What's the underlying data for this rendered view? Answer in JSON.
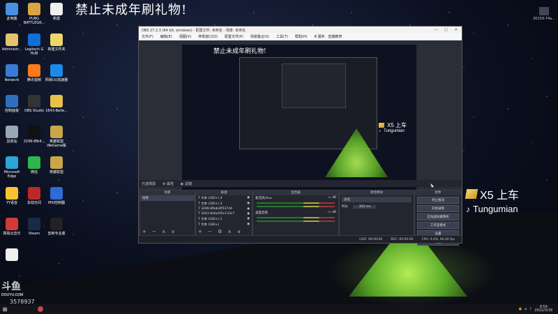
{
  "banner": "禁止未成年刷礼物!",
  "top_right_label": "30159-74a...",
  "desktop_icons": [
    {
      "label": "此电脑",
      "color": "#4a90e2"
    },
    {
      "label": "PUBG BATTLEGR...",
      "color": "#d9a441"
    },
    {
      "label": "新建",
      "color": "#eeeeee"
    },
    {
      "label": "Administr...",
      "color": "#e6c36a"
    },
    {
      "label": "Logitech G HUB",
      "color": "#0e6fd8"
    },
    {
      "label": "新建文件夹",
      "color": "#f0d56a"
    },
    {
      "label": "Network",
      "color": "#3a7bd5"
    },
    {
      "label": "腾讯视频",
      "color": "#ff7a1a"
    },
    {
      "label": "网易UU加速器",
      "color": "#1b8be6"
    },
    {
      "label": "控制面板",
      "color": "#2f6fbf"
    },
    {
      "label": "OBS Studio",
      "color": "#333333"
    },
    {
      "label": "1643-Belle...",
      "color": "#e8c14a"
    },
    {
      "label": "回收站",
      "color": "#9aa7b5"
    },
    {
      "label": "3299-8fb4...",
      "color": "#111111"
    },
    {
      "label": "英雄联盟 WeGame版",
      "color": "#c9a64a"
    },
    {
      "label": "Microsoft Edge",
      "color": "#2aa6d9"
    },
    {
      "label": "微信",
      "color": "#2fb64a"
    },
    {
      "label": "英雄联盟",
      "color": "#c9a64a"
    },
    {
      "label": "YY语音",
      "color": "#f7c431"
    },
    {
      "label": "永劫无间",
      "color": "#c02828"
    },
    {
      "label": "MSI控制器",
      "color": "#2e6bd6"
    },
    {
      "label": "网易云音乐",
      "color": "#d23a3a"
    },
    {
      "label": "Steam",
      "color": "#1b2a44"
    },
    {
      "label": "剪映专业版",
      "color": "#222222"
    },
    {
      "label": "",
      "color": "#f0f0f0"
    }
  ],
  "brand_main": {
    "logo_text": "X5 上车",
    "sub": "Tungumian"
  },
  "obs": {
    "title": "OBS 27.2.3 (64 bit, windows) - 配置文件: 未命名 - 场景: 未命名",
    "menu": [
      "文件(F)",
      "编辑(E)",
      "视图(V)",
      "停靠窗口(D)",
      "配置文件(P)",
      "场景集合(S)",
      "工具(T)",
      "帮助(H)",
      "B 服务 · 直播教育"
    ],
    "preview_banner": "禁止未成年刷礼物!",
    "preview_brand": {
      "logo_text": "X5 上车",
      "sub": "Tungumian"
    },
    "preview_caption": "已选择源",
    "preview_toolbar": [
      "属性",
      "滤镜"
    ],
    "docks": {
      "scenes": {
        "title": "场景",
        "items": [
          "场景"
        ]
      },
      "sources": {
        "title": "来源",
        "items": [
          "文本 (GDI+) 4",
          "文本 (GDI+) 3",
          "3299-8fb4e9f537d4",
          "1643-8a6a5f0c133c7",
          "文本 (GDI+) 2",
          "文本 (GDI+)"
        ]
      },
      "mixer": {
        "title": "混音器",
        "tracks": [
          {
            "name": "麦克风/Aux",
            "level": "-∞ dB"
          },
          {
            "name": "桌面音频",
            "level": "-∞ dB"
          }
        ]
      },
      "transitions": {
        "title": "转场特效",
        "type": "淡化",
        "duration_label": "时长",
        "duration_value": "300 ms"
      },
      "controls": {
        "title": "控件",
        "buttons": [
          "停止推流",
          "开始录制",
          "启动虚拟摄像机",
          "工作室模式",
          "设置",
          "退出"
        ]
      }
    },
    "status": [
      "LIVE: 00:00:00",
      "REC: 00:00:00",
      "CPU: 0.4%, 60.00 fps"
    ]
  },
  "watermark": {
    "brand": "斗鱼",
    "sub": "DOUYU.COM"
  },
  "room_id": "3578937",
  "taskbar": {
    "time": "9:59",
    "date": "2022/3/18"
  }
}
